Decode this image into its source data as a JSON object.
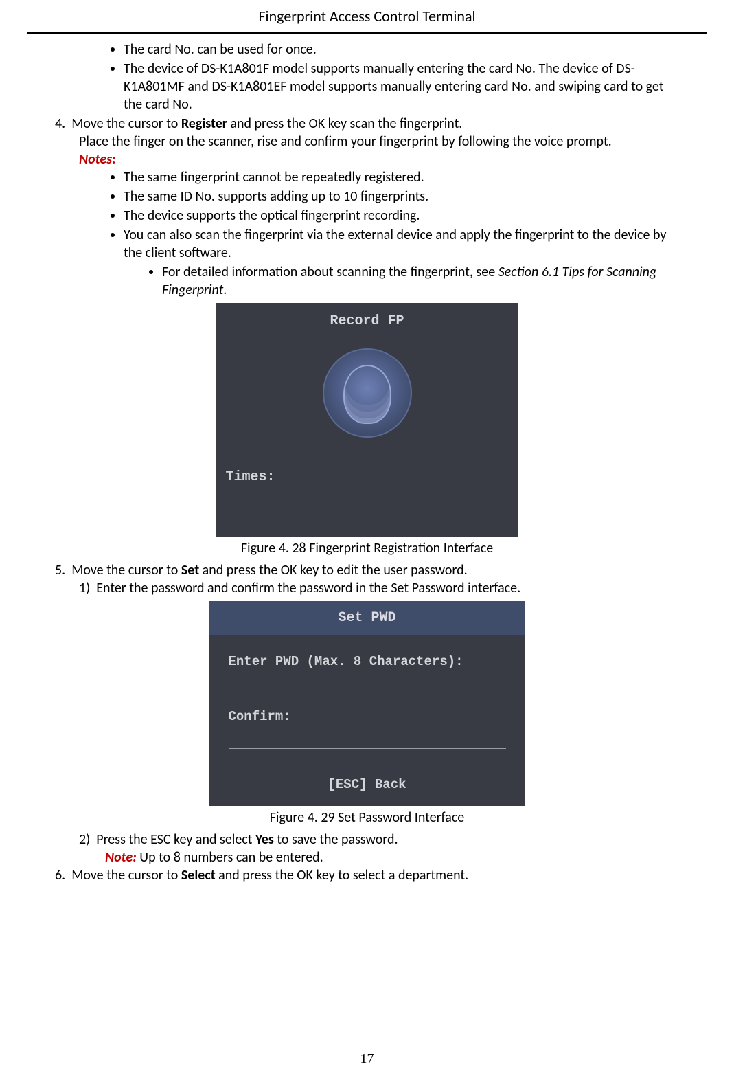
{
  "header": {
    "title": "Fingerprint Access Control Terminal"
  },
  "top_bullets": [
    "The card No. can be used for once.",
    "The device of DS-K1A801F model supports manually entering the card No. The device of DS-K1A801MF and DS-K1A801EF model supports manually entering card No. and swiping card to get the card No."
  ],
  "step4": {
    "num": "4.",
    "line1_pre": "Move the cursor to ",
    "line1_bold": "Register",
    "line1_post": " and press the OK key scan the fingerprint.",
    "line2": "Place the finger on the scanner, rise and confirm your fingerprint by following the voice prompt.",
    "notes_label": "Notes:",
    "notes": [
      "The same fingerprint cannot be repeatedly registered.",
      "The same ID No. supports adding up to 10 fingerprints.",
      "The device supports the optical fingerprint recording.",
      "You can also scan the fingerprint via the external device and apply the fingerprint to the device by the client software."
    ],
    "subnote_pre": "For detailed information about scanning the fingerprint, see ",
    "subnote_italic": "Section 6.1 Tips for Scanning Fingerprint",
    "subnote_post": "."
  },
  "figure1": {
    "screen_title": "Record FP",
    "times_label": "Times:",
    "caption": "Figure 4. 28 Fingerprint Registration Interface"
  },
  "step5": {
    "num": "5.",
    "line_pre": "Move the cursor to ",
    "line_bold": "Set",
    "line_post": " and press the OK key to edit the user password.",
    "sub1_num": "1)",
    "sub1_text": "Enter the password and confirm the password in the Set Password interface."
  },
  "figure2": {
    "screen_title": "Set PWD",
    "enter_label": "Enter PWD (Max. 8 Characters):",
    "confirm_label": "Confirm:",
    "esc_label": "[ESC] Back",
    "caption": "Figure 4. 29 Set Password Interface"
  },
  "step5b": {
    "sub2_num": "2)",
    "sub2_pre": "Press the ESC key and select ",
    "sub2_bold": "Yes",
    "sub2_post": " to save the password.",
    "note_label": "Note:",
    "note_text": " Up to 8 numbers can be entered."
  },
  "step6": {
    "num": "6.",
    "line_pre": "Move the cursor to ",
    "line_bold": "Select",
    "line_post": " and press the OK key to select a department."
  },
  "page_number": "17"
}
